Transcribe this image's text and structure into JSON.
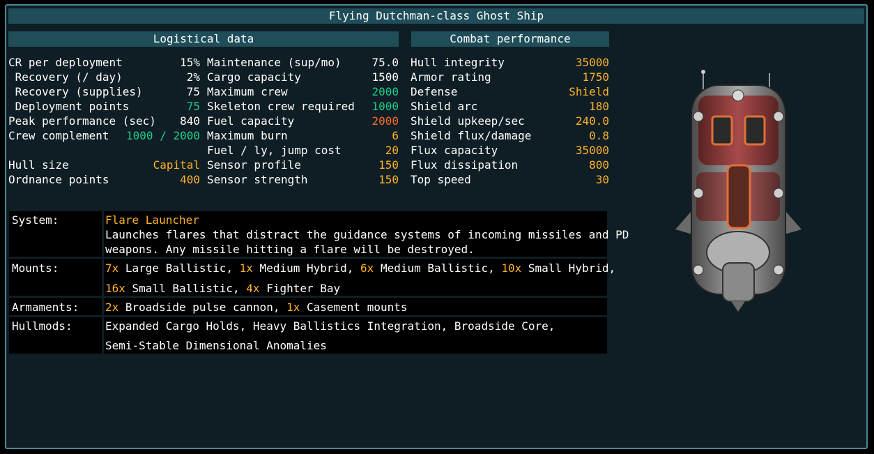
{
  "title": "Flying Dutchman-class Ghost Ship",
  "logistics_header": "Logistical data",
  "combat_header": "Combat performance",
  "logistics_left": [
    {
      "label": "CR per deployment",
      "value": "15%"
    },
    {
      "label": " Recovery (/ day)",
      "value": "2%"
    },
    {
      "label": " Recovery (supplies)",
      "value": "75"
    },
    {
      "label": " Deployment points",
      "value": "75"
    },
    {
      "label": "Peak performance (sec)",
      "value": "840"
    },
    {
      "label": "Crew complement",
      "value": "1000 / 2000"
    },
    {
      "label": "Hull size",
      "value": "Capital"
    },
    {
      "label": "Ordnance points",
      "value": "400"
    }
  ],
  "logistics_right": [
    {
      "label": "Maintenance (sup/mo)",
      "value": "75.0"
    },
    {
      "label": "Cargo capacity",
      "value": "1500"
    },
    {
      "label": "Maximum crew",
      "value": "2000"
    },
    {
      "label": "Skeleton crew required",
      "value": "1000"
    },
    {
      "label": "Fuel capacity",
      "value": "2000"
    },
    {
      "label": "Maximum burn",
      "value": "6"
    },
    {
      "label": "Fuel / ly, jump cost",
      "value": "20"
    },
    {
      "label": "Sensor profile",
      "value": "150"
    },
    {
      "label": "Sensor strength",
      "value": "150"
    }
  ],
  "combat": [
    {
      "label": "Hull integrity",
      "value": "35000"
    },
    {
      "label": "Armor rating",
      "value": "1750"
    },
    {
      "label": "Defense",
      "value": "Shield"
    },
    {
      "label": "Shield arc",
      "value": "180"
    },
    {
      "label": "Shield upkeep/sec",
      "value": "240.0"
    },
    {
      "label": "Shield flux/damage",
      "value": "0.8"
    },
    {
      "label": "Flux capacity",
      "value": "35000"
    },
    {
      "label": "Flux dissipation",
      "value": "800"
    },
    {
      "label": "Top speed",
      "value": "30"
    }
  ],
  "system": {
    "label": "System:",
    "name": "Flare Launcher",
    "desc_line1": "Launches flares that distract the guidance systems of incoming missiles and PD",
    "desc_line2": "weapons. Any missile hitting a flare will be destroyed."
  },
  "mounts": {
    "label": "Mounts:",
    "items": [
      {
        "count": "7x",
        "name": " Large Ballistic, "
      },
      {
        "count": "1x",
        "name": " Medium Hybrid, "
      },
      {
        "count": "6x",
        "name": " Medium Ballistic, "
      },
      {
        "count": "10x",
        "name": " Small Hybrid,"
      },
      {
        "count": "16x",
        "name": " Small Ballistic, "
      },
      {
        "count": "4x",
        "name": " Fighter Bay"
      }
    ]
  },
  "armaments": {
    "label": "Armaments:",
    "items": [
      {
        "count": "2x",
        "name": " Broadside pulse cannon, "
      },
      {
        "count": "1x",
        "name": " Casement mounts"
      }
    ]
  },
  "hullmods": {
    "label": "Hullmods:",
    "line1": "Expanded Cargo Holds, Heavy Ballistics Integration, Broadside Core,",
    "line2": "Semi-Stable Dimensional Anomalies"
  },
  "colors": {
    "accent_yellow": "#ffb22b",
    "accent_green": "#1ed08c",
    "accent_orange": "#ff6b2b",
    "header_bar": "#1f4d5a",
    "panel_bg": "#0f1e24",
    "border": "#4c8895"
  }
}
